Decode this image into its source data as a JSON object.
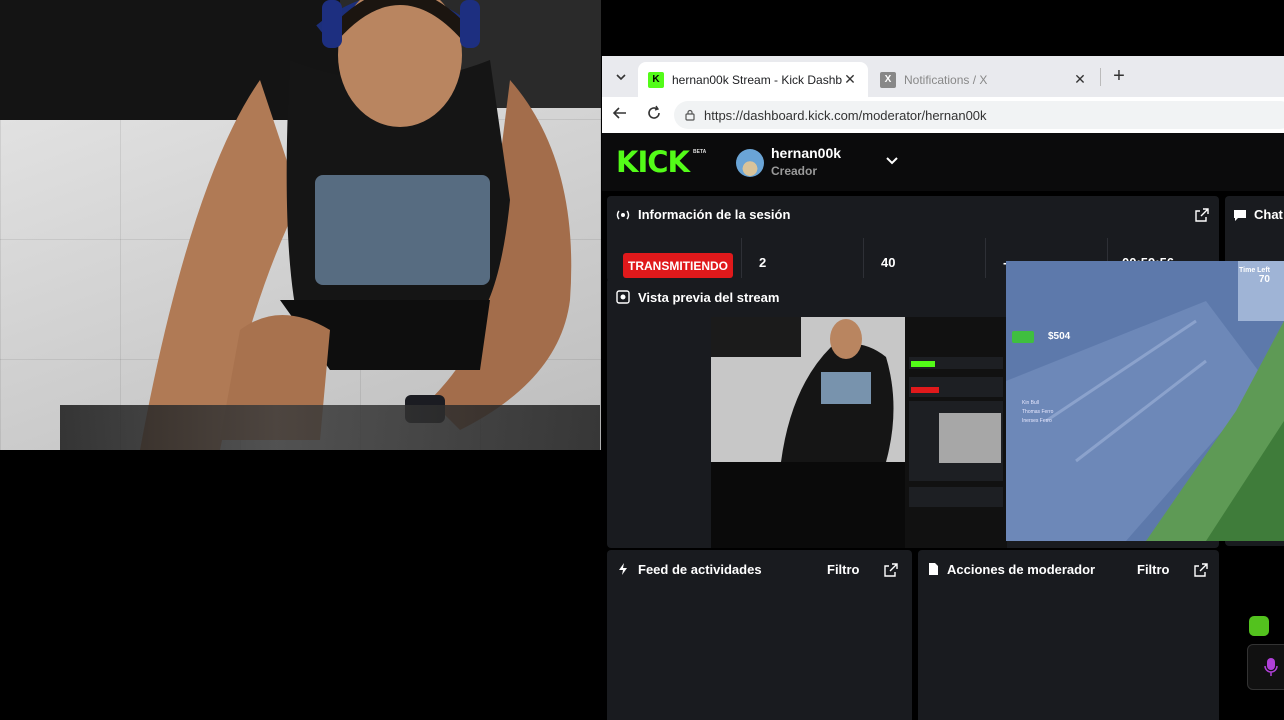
{
  "browser": {
    "tabs": [
      {
        "title": "hernan00k Stream - Kick Dashboard",
        "active": true,
        "favicon": "kick-favicon"
      },
      {
        "title": "Notifications / X",
        "active": false,
        "favicon": "x-favicon"
      }
    ],
    "new_tab_label": "+",
    "url": "https://dashboard.kick.com/moderator/hernan00k"
  },
  "dashboard": {
    "logo": "KICK",
    "logo_badge": "BETA",
    "user": {
      "name": "hernan00k",
      "role": "Creador"
    },
    "session_panel": {
      "title": "Información de la sesión",
      "status_badge": "TRANSMITIENDO",
      "stats": [
        "2",
        "40",
        "-",
        "00:59:56"
      ]
    },
    "preview_panel": {
      "title": "Vista previa del stream"
    },
    "activity_panel": {
      "title": "Feed de actividades",
      "filter_label": "Filtro"
    },
    "moderator_panel": {
      "title": "Acciones de moderador",
      "filter_label": "Filtro"
    },
    "chat_panel": {
      "title": "Chat"
    }
  },
  "game_overlay": {
    "money": "$504",
    "time_label": "Time Left",
    "time_value": "70",
    "feed": [
      "Kin Bull",
      "Thomas Ferro",
      "Inerses Ferro"
    ]
  },
  "colors": {
    "kick_green": "#53fc18",
    "live_red": "#e0191b",
    "panel_bg": "#191b1f",
    "header_bg": "#0b0b0c"
  }
}
